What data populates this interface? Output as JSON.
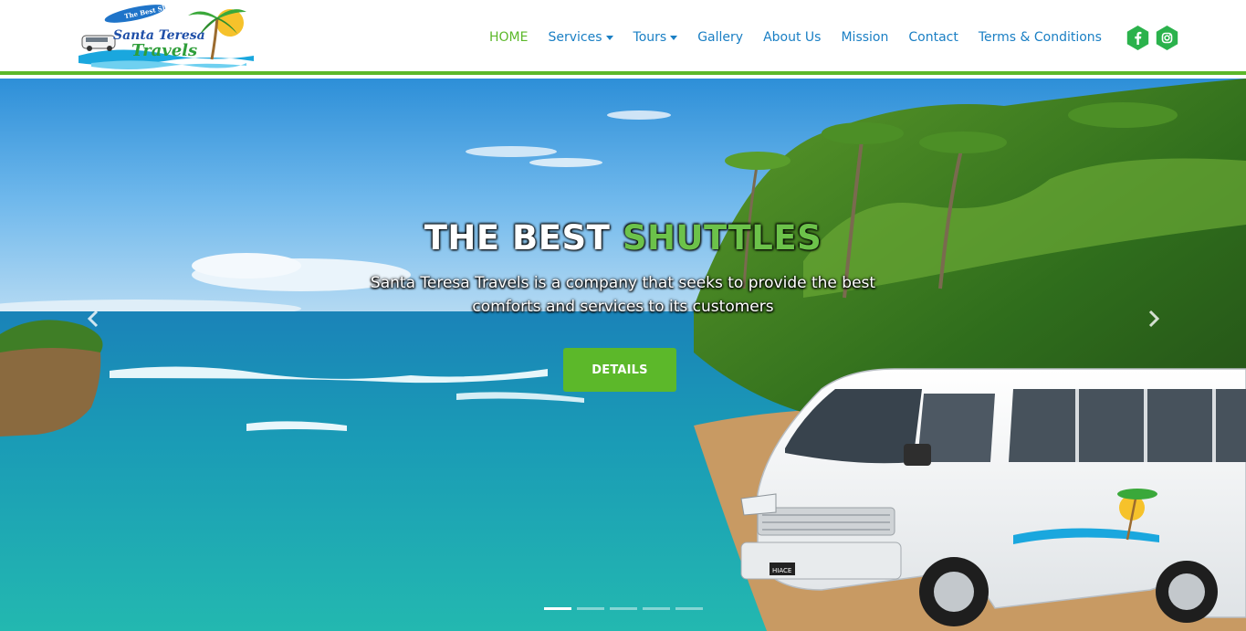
{
  "brand": {
    "name_line1": "Santa Teresa",
    "name_line2": "Travels",
    "tagline": "The Best Shuttles"
  },
  "nav": {
    "items": [
      {
        "label": "HOME",
        "active": true,
        "dropdown": false
      },
      {
        "label": "Services",
        "active": false,
        "dropdown": true
      },
      {
        "label": "Tours",
        "active": false,
        "dropdown": true
      },
      {
        "label": "Gallery",
        "active": false,
        "dropdown": false
      },
      {
        "label": "About Us",
        "active": false,
        "dropdown": false
      },
      {
        "label": "Mission",
        "active": false,
        "dropdown": false
      },
      {
        "label": "Contact",
        "active": false,
        "dropdown": false
      },
      {
        "label": "Terms & Conditions",
        "active": false,
        "dropdown": false
      }
    ]
  },
  "social": {
    "icons": [
      "facebook-icon",
      "instagram-icon"
    ]
  },
  "hero": {
    "title_main": "THE BEST",
    "title_accent": "SHUTTLES",
    "subtitle": "Santa Teresa Travels is a company that seeks to provide the best comforts and services to its customers",
    "button_label": "DETAILS",
    "slide_count": 5,
    "active_slide": 1,
    "van_badge": "HIACE"
  },
  "colors": {
    "nav_link": "#1a7fc4",
    "accent_green": "#5cb82a",
    "social_bg": "#2bb24c"
  }
}
